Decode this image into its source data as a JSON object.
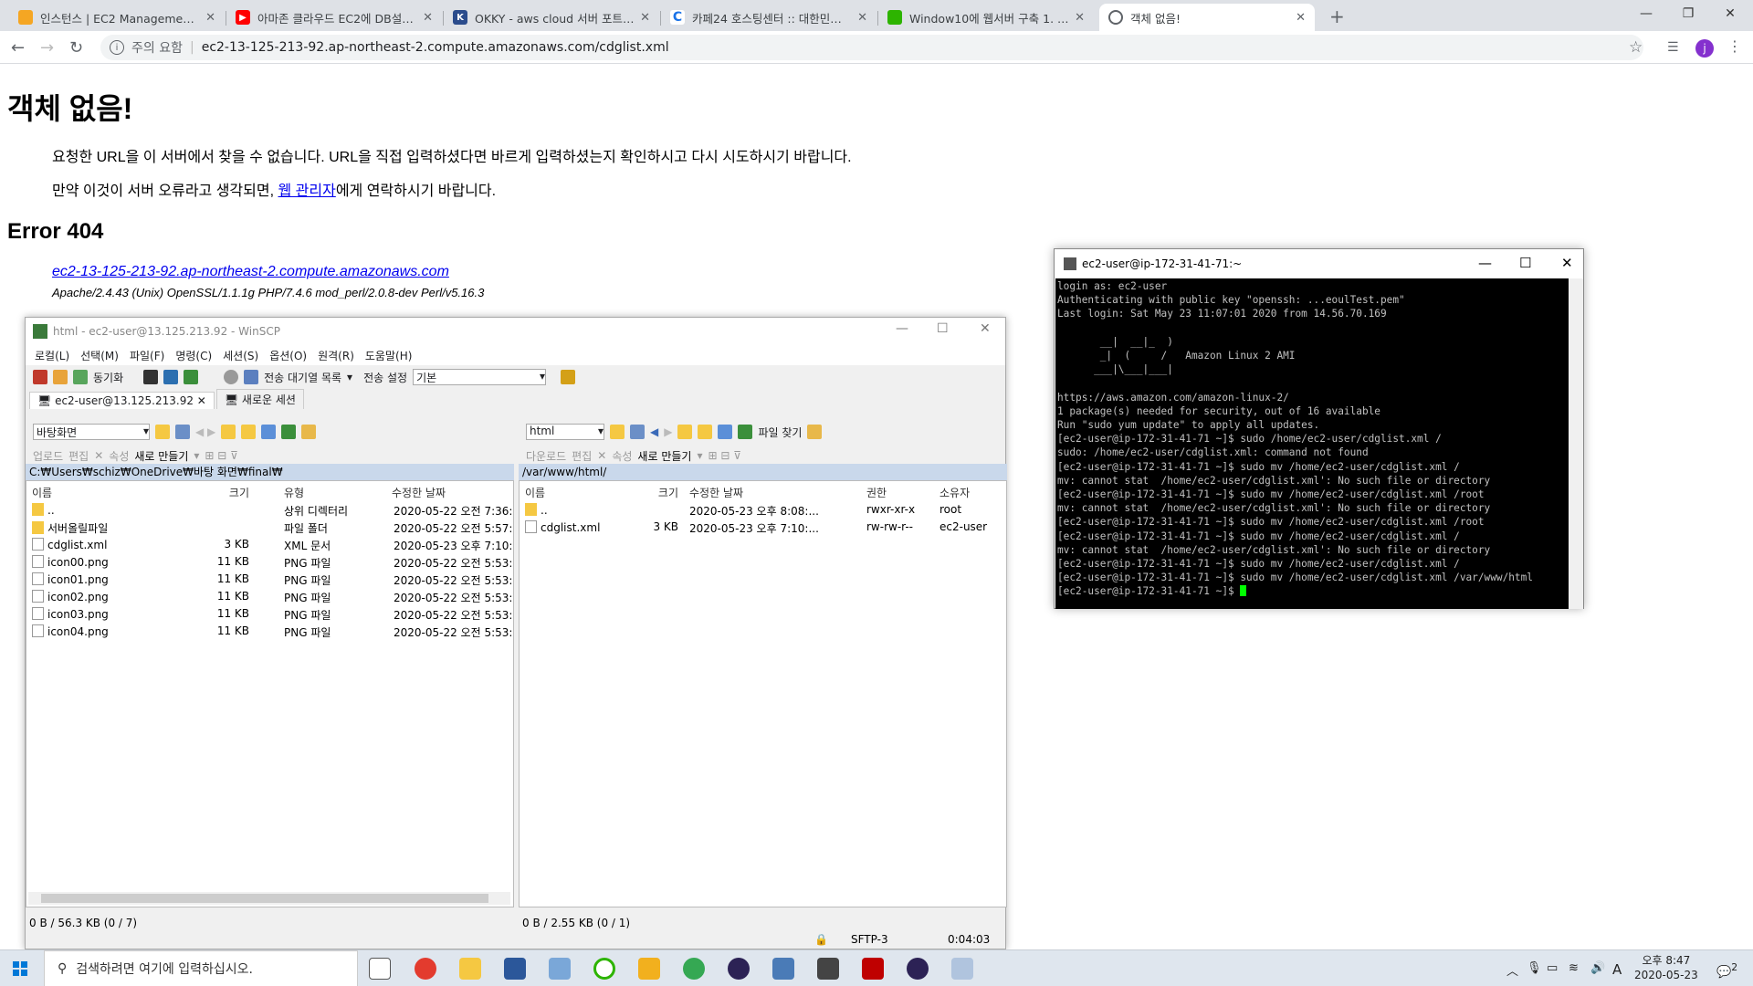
{
  "browser": {
    "tabs": [
      {
        "title": "인스턴스 | EC2 Management Co",
        "fav_color": "#f5a623"
      },
      {
        "title": "아마존 클라우드 EC2에 DB설정하",
        "fav_color": "#ff0000"
      },
      {
        "title": "OKKY - aws cloud 서버 포트 80",
        "fav_color": "#2b4c8c"
      },
      {
        "title": "카페24 호스팅센터 :: 대한민국 N",
        "fav_color": "#1a73e8"
      },
      {
        "title": "Window10에 웹서버 구축 1. 아파",
        "fav_color": "#2db400"
      },
      {
        "title": "객체 없음!",
        "fav_color": "#5f6368"
      }
    ],
    "address": {
      "warning": "주의 요함",
      "url": "ec2-13-125-213-92.ap-northeast-2.compute.amazonaws.com/cdglist.xml"
    },
    "avatar_letter": "j"
  },
  "page": {
    "heading": "객체 없음!",
    "p1": "요청한 URL을 이 서버에서 찾을 수 없습니다. URL을 직접 입력하셨다면 바르게 입력하셨는지 확인하시고 다시 시도하시기 바랍니다.",
    "p2_before": "만약 이것이 서버 오류라고 생각되면, ",
    "p2_link": "웹 관리자",
    "p2_after": "에게 연락하시기 바랍니다.",
    "error": "Error 404",
    "host_link": "ec2-13-125-213-92.ap-northeast-2.compute.amazonaws.com",
    "server_sig": "Apache/2.4.43 (Unix) OpenSSL/1.1.1g PHP/7.4.6 mod_perl/2.0.8-dev Perl/v5.16.3"
  },
  "winscp": {
    "title": "html - ec2-user@13.125.213.92 - WinSCP",
    "menu": [
      "로컬(L)",
      "선택(M)",
      "파일(F)",
      "명령(C)",
      "세션(S)",
      "옵션(O)",
      "원격(R)",
      "도움말(H)"
    ],
    "toolbar": {
      "sync": "동기화",
      "queue": "전송 대기열 목록",
      "transfer_label": "전송 설정",
      "transfer_value": "기본"
    },
    "session_tabs": [
      "ec2-user@13.125.213.92",
      "새로운 세션"
    ],
    "left": {
      "location": "바탕화면",
      "upload": "업로드",
      "edit": "편집",
      "props": "속성",
      "newdir": "새로 만들기",
      "path": "C:₩Users₩schiz₩OneDrive₩바탕 화면₩final₩",
      "headers": [
        "이름",
        "크기",
        "유형",
        "수정한 날짜"
      ],
      "rows": [
        {
          "name": "..",
          "size": "",
          "type": "상위 디렉터리",
          "date": "2020-05-22  오전 7:36:",
          "icon": "up"
        },
        {
          "name": "서버올릴파일",
          "size": "",
          "type": "파일 폴더",
          "date": "2020-05-22  오전 5:57:",
          "icon": "folder"
        },
        {
          "name": "cdglist.xml",
          "size": "3 KB",
          "type": "XML 문서",
          "date": "2020-05-23  오후 7:10:",
          "icon": "file"
        },
        {
          "name": "icon00.png",
          "size": "11 KB",
          "type": "PNG 파일",
          "date": "2020-05-22  오전 5:53:",
          "icon": "file"
        },
        {
          "name": "icon01.png",
          "size": "11 KB",
          "type": "PNG 파일",
          "date": "2020-05-22  오전 5:53:",
          "icon": "file"
        },
        {
          "name": "icon02.png",
          "size": "11 KB",
          "type": "PNG 파일",
          "date": "2020-05-22  오전 5:53:",
          "icon": "file"
        },
        {
          "name": "icon03.png",
          "size": "11 KB",
          "type": "PNG 파일",
          "date": "2020-05-22  오전 5:53:",
          "icon": "file"
        },
        {
          "name": "icon04.png",
          "size": "11 KB",
          "type": "PNG 파일",
          "date": "2020-05-22  오전 5:53:",
          "icon": "file"
        }
      ],
      "status": "0 B / 56.3 KB (0 / 7)"
    },
    "right": {
      "location": "html",
      "download": "다운로드",
      "edit": "편집",
      "props": "속성",
      "newdir": "새로 만들기",
      "find": "파일 찾기",
      "path": "/var/www/html/",
      "headers": [
        "이름",
        "크기",
        "수정한 날짜",
        "권한",
        "소유자"
      ],
      "rows": [
        {
          "name": "..",
          "size": "",
          "date": "2020-05-23 오후 8:08:...",
          "perm": "rwxr-xr-x",
          "owner": "root",
          "icon": "up"
        },
        {
          "name": "cdglist.xml",
          "size": "3 KB",
          "date": "2020-05-23 오후 7:10:...",
          "perm": "rw-rw-r--",
          "owner": "ec2-user",
          "icon": "file"
        }
      ],
      "status": "0 B / 2.55 KB (0 / 1)"
    },
    "statusbar": {
      "protocol": "SFTP-3",
      "time": "0:04:03"
    }
  },
  "putty": {
    "title": "ec2-user@ip-172-31-41-71:~",
    "lines": [
      "login as: ec2-user",
      "Authenticating with public key \"openssh: ...eoulTest.pem\"",
      "Last login: Sat May 23 11:07:01 2020 from 14.56.70.169",
      "",
      "       __|  __|_  )",
      "       _|  (     /   Amazon Linux 2 AMI",
      "      ___|\\___|___|",
      "",
      "https://aws.amazon.com/amazon-linux-2/",
      "1 package(s) needed for security, out of 16 available",
      "Run \"sudo yum update\" to apply all updates.",
      "[ec2-user@ip-172-31-41-71 ~]$ sudo /home/ec2-user/cdglist.xml /",
      "sudo: /home/ec2-user/cdglist.xml: command not found",
      "[ec2-user@ip-172-31-41-71 ~]$ sudo mv /home/ec2-user/cdglist.xml /",
      "mv: cannot stat  /home/ec2-user/cdglist.xml': No such file or directory",
      "[ec2-user@ip-172-31-41-71 ~]$ sudo mv /home/ec2-user/cdglist.xml /root",
      "mv: cannot stat  /home/ec2-user/cdglist.xml': No such file or directory",
      "[ec2-user@ip-172-31-41-71 ~]$ sudo mv /home/ec2-user/cdglist.xml /root",
      "[ec2-user@ip-172-31-41-71 ~]$ sudo mv /home/ec2-user/cdglist.xml /",
      "mv: cannot stat  /home/ec2-user/cdglist.xml': No such file or directory",
      "[ec2-user@ip-172-31-41-71 ~]$ sudo mv /home/ec2-user/cdglist.xml /",
      "[ec2-user@ip-172-31-41-71 ~]$ sudo mv /home/ec2-user/cdglist.xml /var/www/html"
    ],
    "prompt": "[ec2-user@ip-172-31-41-71 ~]$ "
  },
  "taskbar": {
    "search_placeholder": "검색하려면 여기에 입력하십시오.",
    "ime": "A",
    "time": "오후 8:47",
    "date": "2020-05-23",
    "notif_count": "2"
  }
}
